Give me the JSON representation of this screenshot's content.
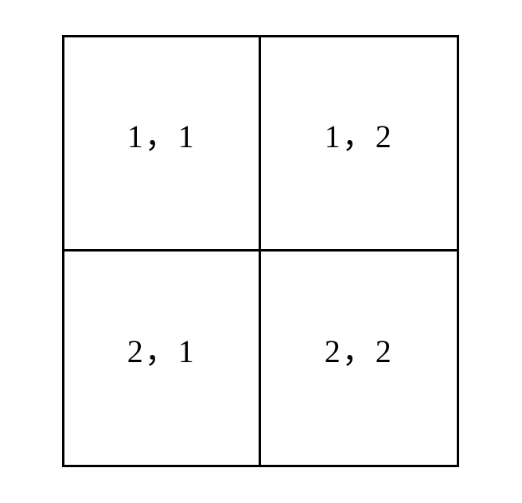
{
  "grid": {
    "cells": [
      [
        "1，1",
        "1，2"
      ],
      [
        "2，1",
        "2，2"
      ]
    ]
  }
}
